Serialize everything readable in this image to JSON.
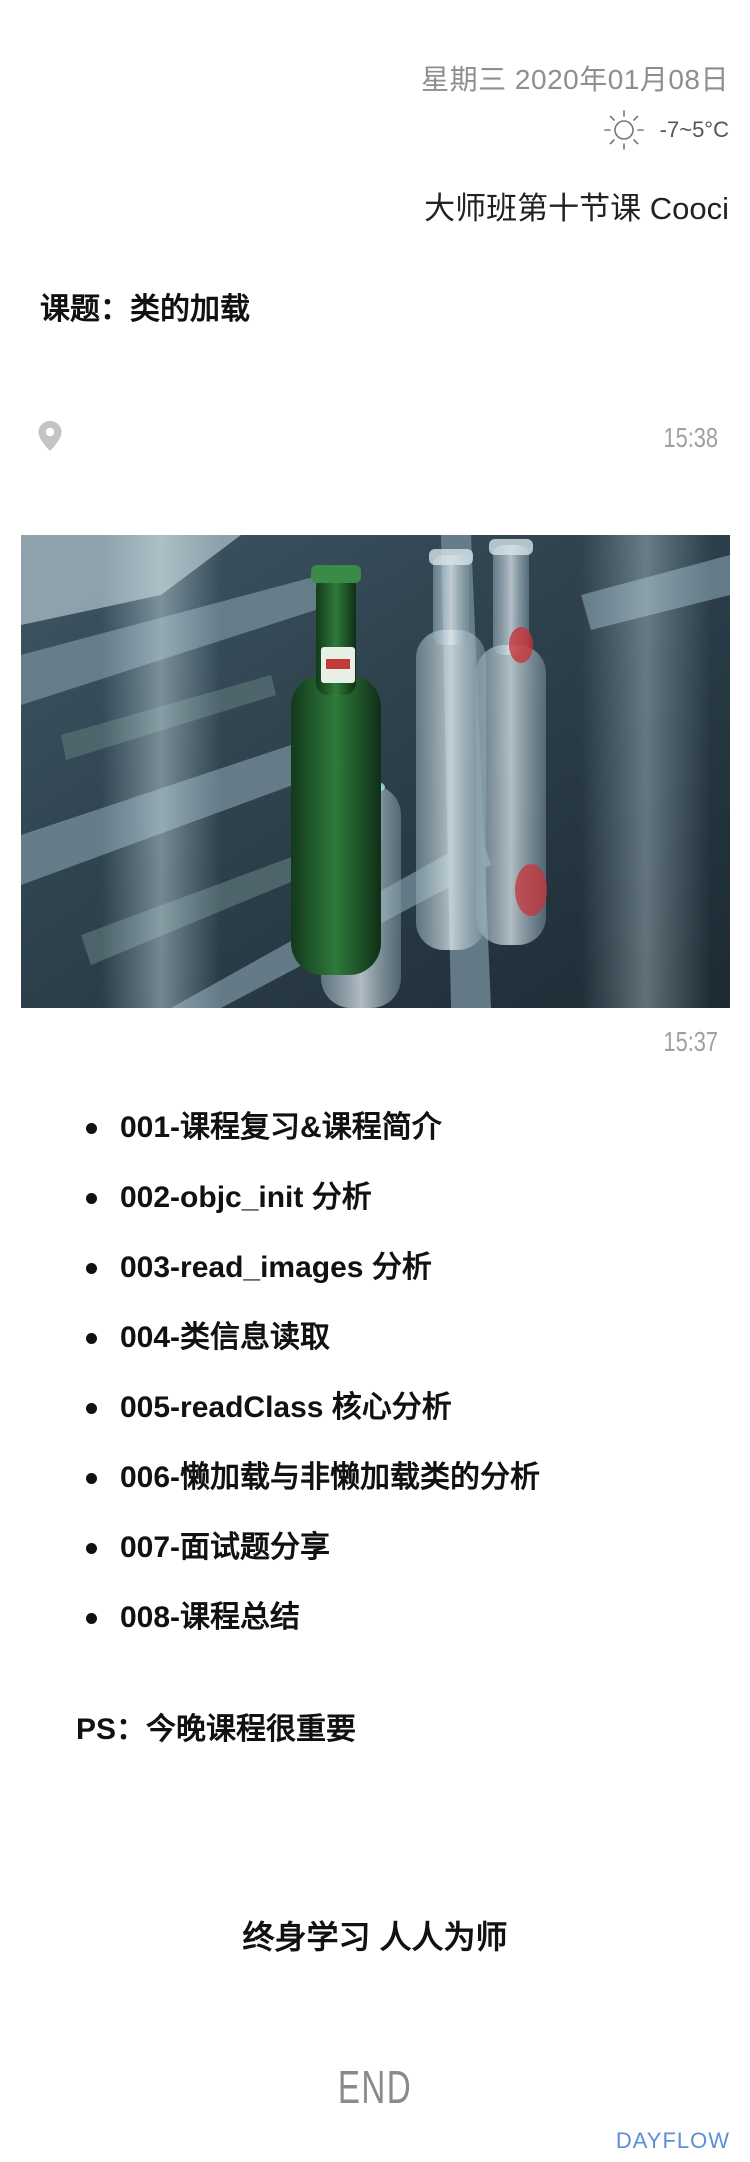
{
  "header": {
    "date": "星期三 2020年01月08日",
    "weather_icon": "sun-icon",
    "temperature": "-7~5°C",
    "class_title": "大师班第十节课 Cooci"
  },
  "topic": "课题：类的加载",
  "location": {
    "icon": "location-pin-icon",
    "time": "15:38"
  },
  "photo": {
    "time": "15:37"
  },
  "agenda": [
    "001-课程复习&课程简介",
    "002-objc_init 分析",
    "003-read_images 分析",
    "004-类信息读取",
    "005-readClass 核心分析",
    "006-懒加载与非懒加载类的分析",
    "007-面试题分享",
    "008-课程总结"
  ],
  "ps": "PS：今晚课程很重要",
  "motto": "终身学习 人人为师",
  "end": "END",
  "brand": "DAYFLOW",
  "colors": {
    "muted_text": "#8e8e8e",
    "time_text": "#a0a0a0",
    "brand": "#5b8fd8"
  }
}
